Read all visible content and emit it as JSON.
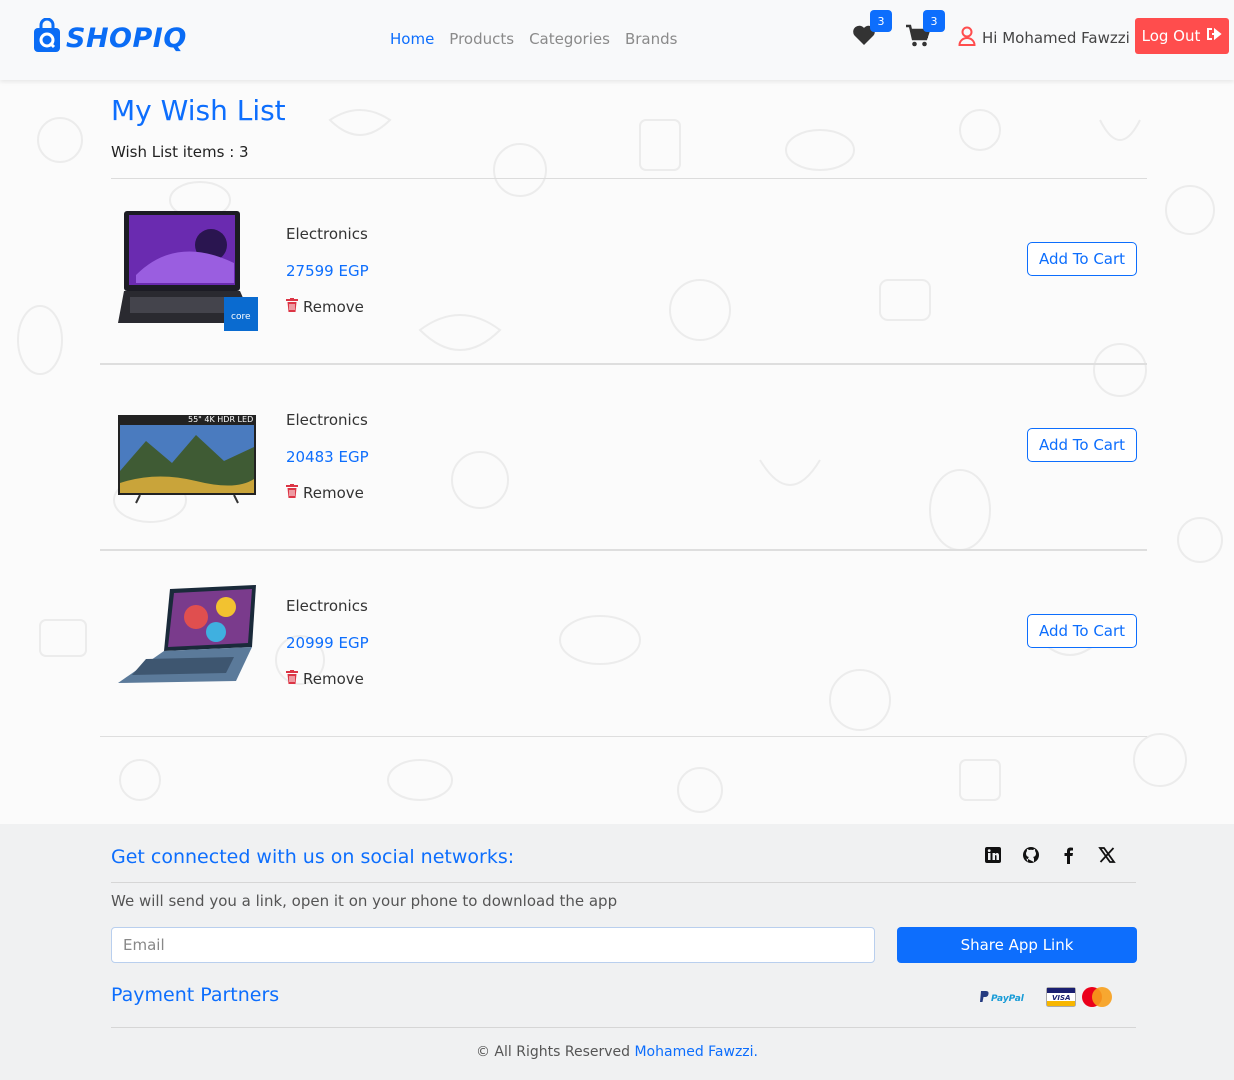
{
  "nav": {
    "logo_text": "SHOPIQ",
    "links": [
      "Home",
      "Products",
      "Categories",
      "Brands"
    ],
    "wishlist_count": "3",
    "cart_count": "3",
    "greeting": "Hi Mohamed Fawzzi",
    "logout_label": "Log Out"
  },
  "wishlist": {
    "title": "My Wish List",
    "count_text": "Wish List items : 3",
    "items": [
      {
        "category": "Electronics",
        "price": "27599 EGP",
        "remove_label": "Remove",
        "add_label": "Add To Cart",
        "image": "laptop-icon"
      },
      {
        "category": "Electronics",
        "price": "20483 EGP",
        "remove_label": "Remove",
        "add_label": "Add To Cart",
        "image": "tv-icon",
        "image_caption": "55\" 4K HDR LED"
      },
      {
        "category": "Electronics",
        "price": "20999 EGP",
        "remove_label": "Remove",
        "add_label": "Add To Cart",
        "image": "laptop-icon"
      }
    ]
  },
  "footer": {
    "social_title": "Get connected with us on social networks:",
    "social_icons": [
      "linkedin-icon",
      "github-icon",
      "facebook-icon",
      "x-icon"
    ],
    "description": "We will send you a link, open it on your phone to download the app",
    "email_placeholder": "Email",
    "share_label": "Share App Link",
    "partners_title": "Payment Partners",
    "paypal_text": "PayPal",
    "visa_text": "VISA",
    "copyright_prefix": "© All Rights Reserved",
    "copyright_author": "Mohamed Fawzzi",
    "copyright_suffix": "."
  },
  "colors": {
    "accent": "#0d6efd",
    "logout": "#ff4d4d",
    "remove_icon": "#dc3545"
  }
}
